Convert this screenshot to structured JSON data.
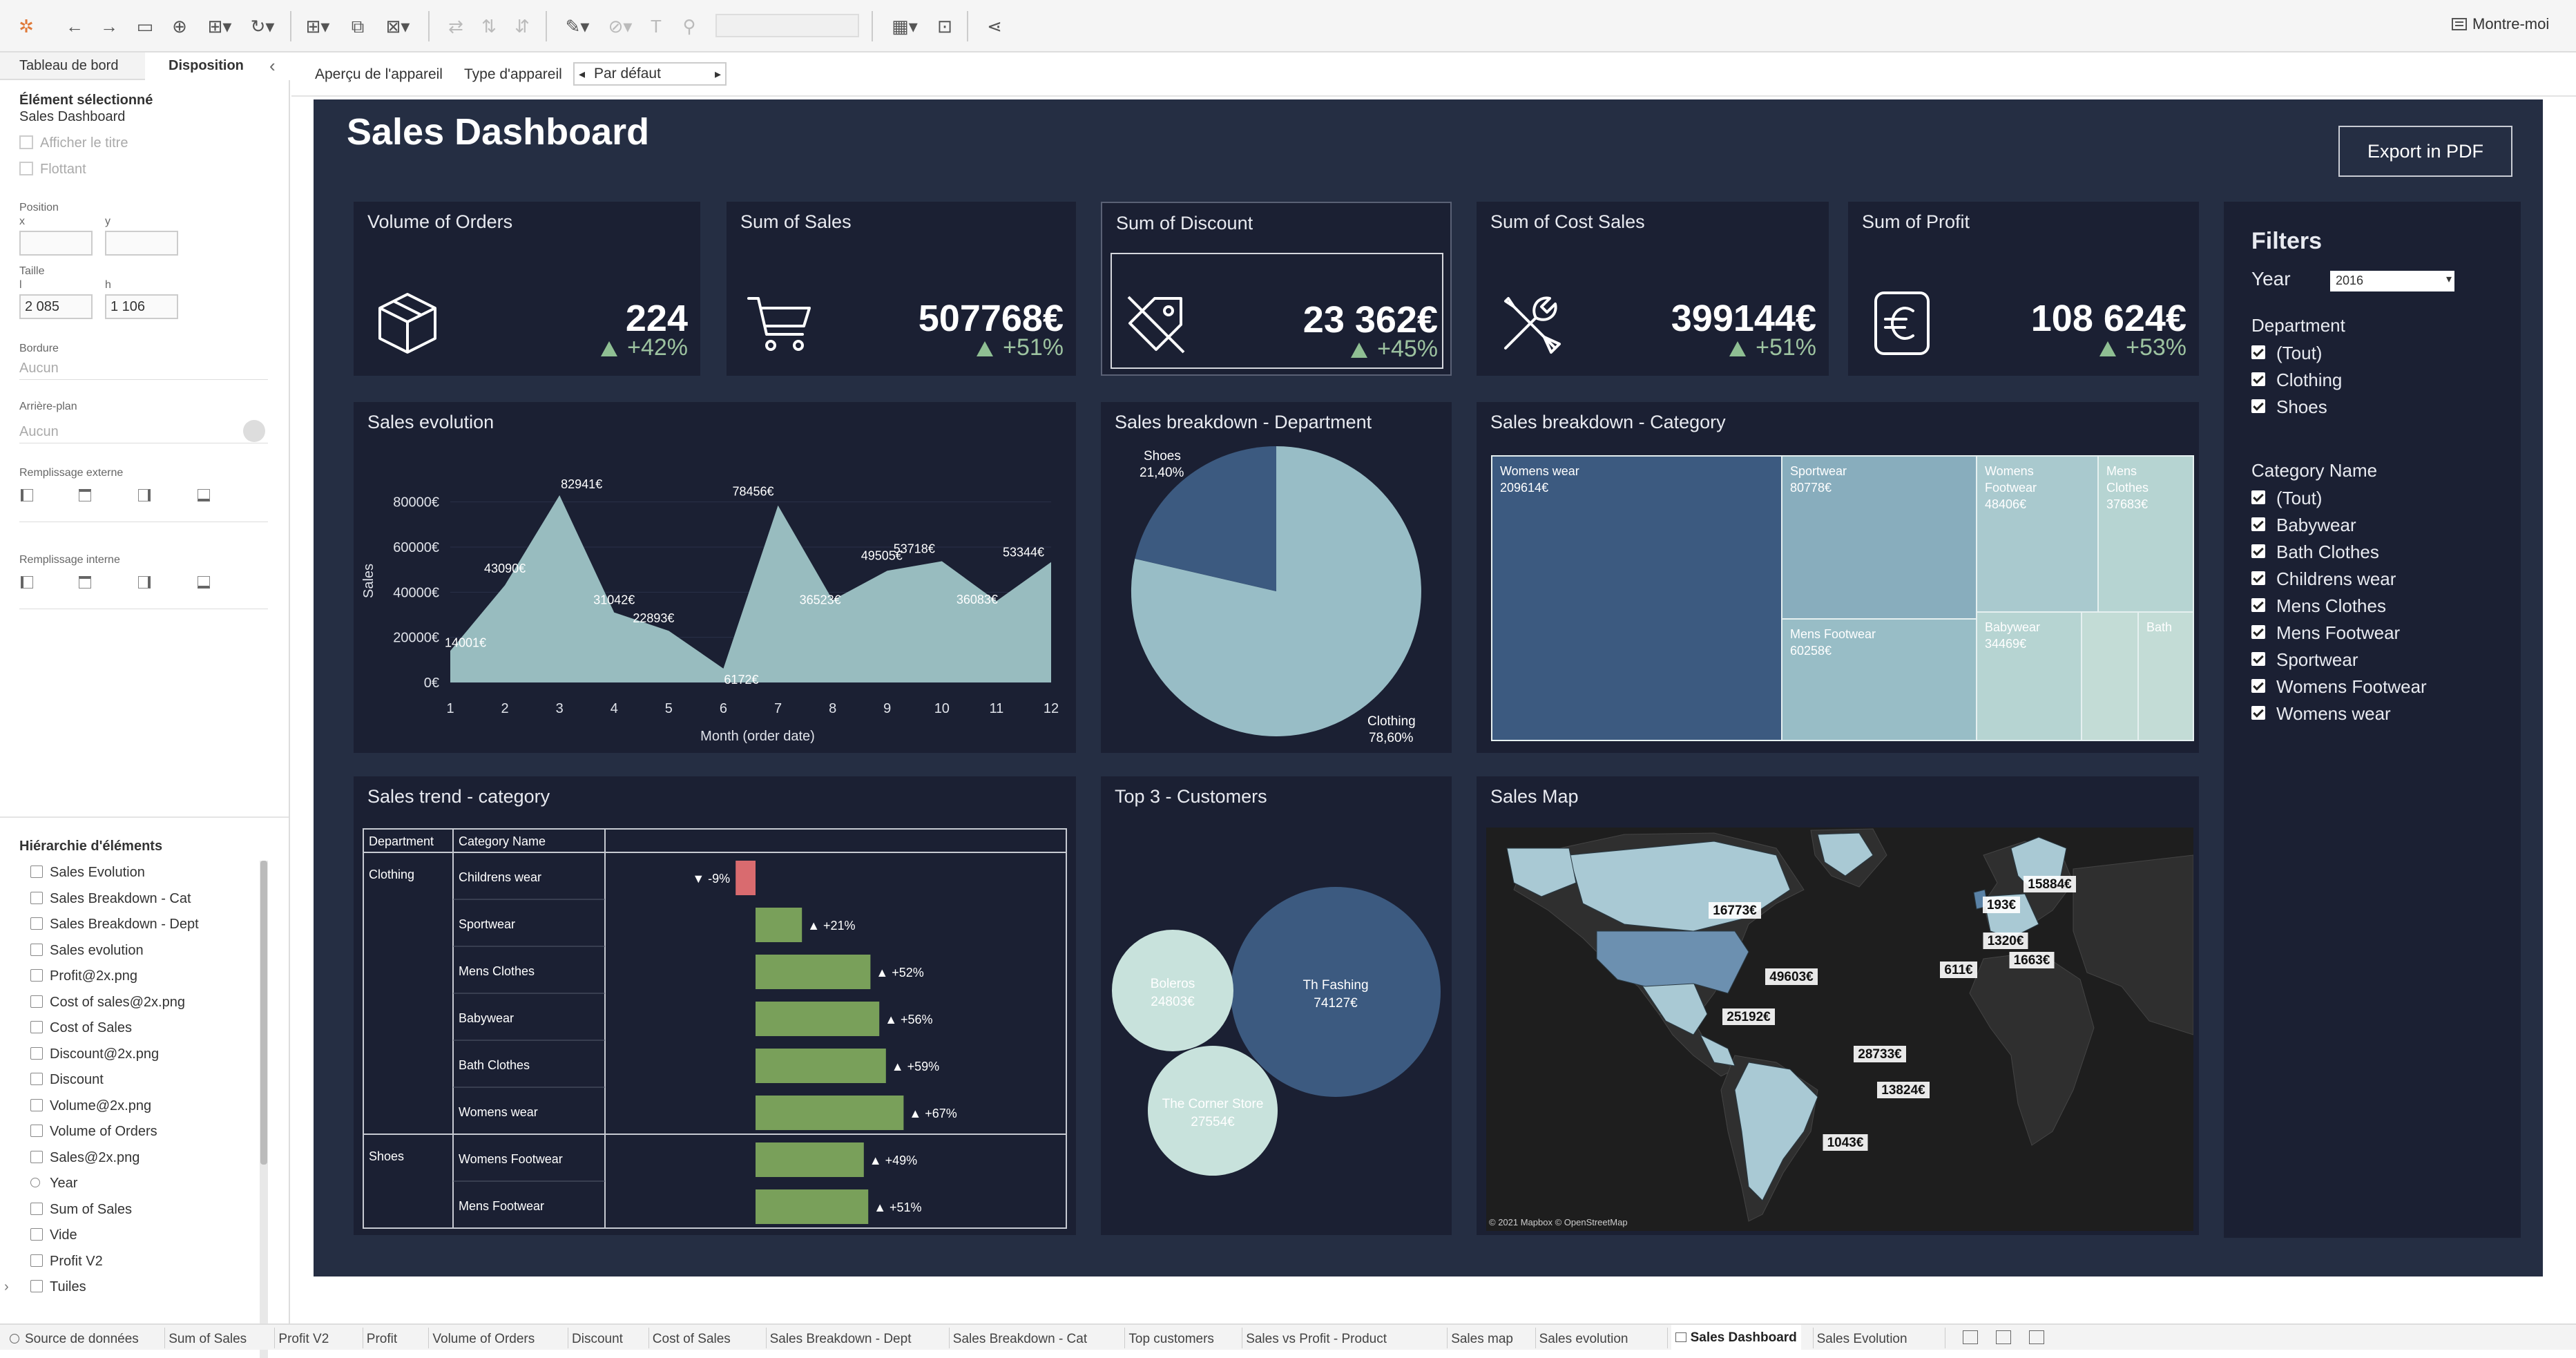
{
  "toolbar": {
    "show_me_label": "Montre-moi",
    "icons": [
      "tableau-logo-icon",
      "undo-icon",
      "redo-icon",
      "save-icon",
      "new-datasource-icon",
      "pause-icon",
      "refresh-icon",
      "new-sheet-icon",
      "duplicate-icon",
      "clear-icon",
      "swap-icon",
      "sort-asc-icon",
      "sort-desc-icon",
      "highlight-icon",
      "group-icon",
      "label-icon",
      "pin-icon",
      "fit-icon",
      "presentation-icon",
      "share-icon"
    ]
  },
  "left_panel": {
    "tabs": [
      "Tableau de bord",
      "Disposition"
    ],
    "selected_element_heading": "Élément sélectionné",
    "selected_element_name": "Sales Dashboard",
    "show_title_label": "Afficher le titre",
    "floating_label": "Flottant",
    "position_label": "Position",
    "x_label": "x",
    "y_label": "y",
    "size_label": "Taille",
    "w_label": "l",
    "h_label": "h",
    "w_value": "2 085",
    "h_value": "1 106",
    "border_label": "Bordure",
    "border_value": "Aucun",
    "background_label": "Arrière-plan",
    "background_value": "Aucun",
    "outer_padding_label": "Remplissage externe",
    "inner_padding_label": "Remplissage interne",
    "hierarchy_heading": "Hiérarchie d'éléments",
    "hierarchy_items": [
      {
        "label": "Sales Evolution",
        "icon": "sheet-icon"
      },
      {
        "label": "Sales Breakdown - Cat",
        "icon": "sheet-icon"
      },
      {
        "label": "Sales Breakdown - Dept",
        "icon": "sheet-icon"
      },
      {
        "label": "Sales evolution",
        "icon": "sheet-icon"
      },
      {
        "label": "Profit@2x.png",
        "icon": "image-icon"
      },
      {
        "label": "Cost of sales@2x.png",
        "icon": "image-icon"
      },
      {
        "label": "Cost of Sales",
        "icon": "sheet-icon"
      },
      {
        "label": "Discount@2x.png",
        "icon": "image-icon"
      },
      {
        "label": "Discount",
        "icon": "sheet-icon"
      },
      {
        "label": "Volume@2x.png",
        "icon": "image-icon"
      },
      {
        "label": "Volume of Orders",
        "icon": "sheet-icon"
      },
      {
        "label": "Sales@2x.png",
        "icon": "image-icon"
      },
      {
        "label": "Year",
        "icon": "parameter-icon"
      },
      {
        "label": "Sum of Sales",
        "icon": "sheet-icon"
      },
      {
        "label": "Vide",
        "icon": "blank-icon"
      },
      {
        "label": "Profit V2",
        "icon": "sheet-icon"
      },
      {
        "label": "Tuiles",
        "icon": "tiled-icon"
      }
    ]
  },
  "canvas_toolbar": {
    "device_preview_label": "Aperçu de l'appareil",
    "device_type_label": "Type d'appareil",
    "device_type_value": "Par défaut"
  },
  "dashboard": {
    "title": "Sales Dashboard",
    "export_button": "Export in PDF",
    "kpis": [
      {
        "title": "Volume of Orders",
        "value": "224",
        "delta": "+42%",
        "icon": "box-icon"
      },
      {
        "title": "Sum of Sales",
        "value": "507768€",
        "delta": "+51%",
        "icon": "cart-icon"
      },
      {
        "title": "Sum of Discount",
        "value": "23 362€",
        "delta": "+45%",
        "icon": "tag-icon"
      },
      {
        "title": "Sum of Cost Sales",
        "value": "399144€",
        "delta": "+51%",
        "icon": "tools-icon"
      },
      {
        "title": "Sum of Profit",
        "value": "108 624€",
        "delta": "+53%",
        "icon": "euro-icon"
      }
    ],
    "filters": {
      "title": "Filters",
      "year_label": "Year",
      "year_value": "2016",
      "department_label": "Department",
      "department_items": [
        "(Tout)",
        "Clothing",
        "Shoes"
      ],
      "category_label": "Category Name",
      "category_items": [
        "(Tout)",
        "Babywear",
        "Bath Clothes",
        "Childrens wear",
        "Mens Clothes",
        "Mens Footwear",
        "Sportwear",
        "Womens Footwear",
        "Womens wear"
      ]
    },
    "sales_evolution": {
      "title": "Sales evolution",
      "xlabel": "Month (order date)",
      "ylabel": "Sales"
    },
    "dept_breakdown": {
      "title": "Sales breakdown - Department"
    },
    "cat_breakdown": {
      "title": "Sales breakdown - Category"
    },
    "trend": {
      "title": "Sales trend - category",
      "col_department": "Department",
      "col_category": "Category Name"
    },
    "customers": {
      "title": "Top 3 - Customers"
    },
    "map": {
      "title": "Sales Map",
      "attribution": "© 2021 Mapbox © OpenStreetMap",
      "labels": [
        "15884€",
        "193€",
        "16773€",
        "1320€",
        "1663€",
        "611€",
        "49603€",
        "25192€",
        "28733€",
        "13824€",
        "1043€"
      ]
    }
  },
  "chart_data": [
    {
      "type": "area",
      "x": [
        1,
        2,
        3,
        4,
        5,
        6,
        7,
        8,
        9,
        10,
        11,
        12
      ],
      "values": [
        14001,
        43090,
        82941,
        31042,
        22893,
        6172,
        78456,
        36523,
        49505,
        53718,
        36083,
        53344
      ],
      "labels": [
        "14001€",
        "43090€",
        "82941€",
        "31042€",
        "22893€",
        "6172€",
        "78456€",
        "36523€",
        "49505€",
        "53718€",
        "36083€",
        "53344€"
      ],
      "ylim": [
        0,
        90000
      ],
      "yticks": [
        0,
        20000,
        40000,
        60000,
        80000
      ],
      "ytick_labels": [
        "0€",
        "20000€",
        "40000€",
        "60000€",
        "80000€"
      ],
      "xtick_labels": [
        "1",
        "2",
        "3",
        "4",
        "5",
        "6",
        "7",
        "8",
        "9",
        "10",
        "11",
        "12"
      ],
      "xlabel": "Month (order date)",
      "ylabel": "Sales",
      "color": "#98bcbf"
    },
    {
      "type": "pie",
      "categories": [
        "Shoes",
        "Clothing"
      ],
      "values": [
        21.4,
        78.6
      ],
      "labels": [
        "21,40%",
        "78,60%"
      ],
      "colors": [
        "#3c5a80",
        "#98bdc6"
      ]
    },
    {
      "type": "heatmap",
      "subtype": "treemap",
      "categories": [
        "Womens wear",
        "Sportwear",
        "Mens Footwear",
        "Womens Footwear",
        "Mens Clothes",
        "Babywear",
        "Childrens wear",
        "Bath Clothes"
      ],
      "values": [
        209614,
        80778,
        60258,
        48406,
        37683,
        34469,
        null,
        null
      ],
      "labels": [
        "209614€",
        "80778€",
        "60258€",
        "48406€",
        "37683€",
        "34469€",
        "",
        ""
      ],
      "display_names": [
        "Womens wear",
        "Sportwear",
        "Mens Footwear",
        "Womens Footwear",
        "Mens Clothes",
        "Babywear",
        "",
        "Bath"
      ]
    },
    {
      "type": "bar",
      "orientation": "horizontal",
      "groups": [
        {
          "department": "Clothing",
          "categories": [
            "Childrens wear",
            "Sportwear",
            "Mens Clothes",
            "Babywear",
            "Bath Clothes",
            "Womens wear"
          ],
          "values": [
            -9,
            21,
            52,
            56,
            59,
            67
          ],
          "labels": [
            "-9%",
            "+21%",
            "+52%",
            "+56%",
            "+59%",
            "+67%"
          ]
        },
        {
          "department": "Shoes",
          "categories": [
            "Womens Footwear",
            "Mens Footwear"
          ],
          "values": [
            49,
            51
          ],
          "labels": [
            "+49%",
            "+51%"
          ]
        }
      ],
      "colors": {
        "positive": "#79a05a",
        "negative": "#d96b6f"
      }
    },
    {
      "type": "scatter",
      "subtype": "bubble",
      "categories": [
        "Th Fashing",
        "Boleros",
        "The Corner Store"
      ],
      "values": [
        74127,
        24803,
        27554
      ],
      "labels": [
        "74127€",
        "24803€",
        "27554€"
      ],
      "colors": [
        "#3c5a80",
        "#c8e2dc",
        "#c8e2dc"
      ]
    }
  ],
  "bottom_tabs": [
    "Source de données",
    "Sum of Sales",
    "Profit V2",
    "Profit",
    "Volume of Orders",
    "Discount",
    "Cost of Sales",
    "Sales Breakdown - Dept",
    "Sales Breakdown - Cat",
    "Top customers",
    "Sales vs Profit - Product",
    "Sales map",
    "Sales evolution",
    "Sales Dashboard",
    "Sales Evolution"
  ],
  "active_bottom_tab": "Sales Dashboard"
}
